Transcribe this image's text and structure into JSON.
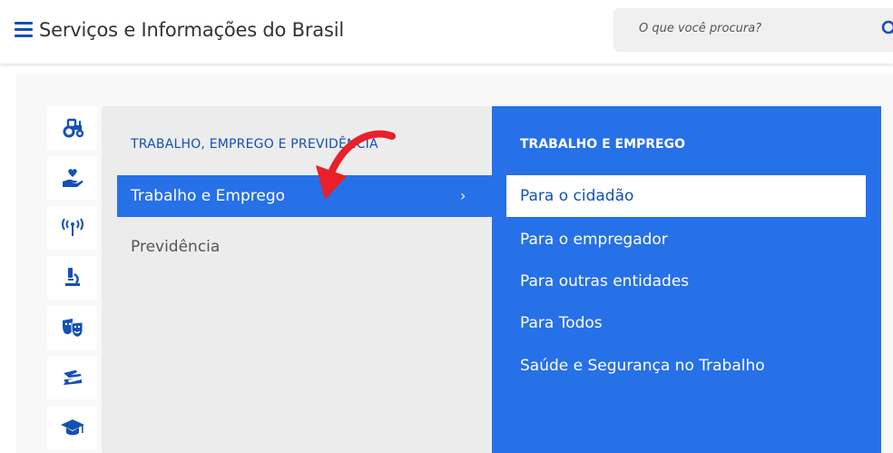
{
  "header": {
    "title": "Serviços e Informações do Brasil",
    "search_placeholder": "O que você procura?"
  },
  "categories": [
    {
      "icon": "tractor-icon"
    },
    {
      "icon": "hand-heart-icon"
    },
    {
      "icon": "antenna-icon"
    },
    {
      "icon": "microscope-icon"
    },
    {
      "icon": "theater-masks-icon"
    },
    {
      "icon": "handshake-icon"
    },
    {
      "icon": "graduation-cap-icon"
    }
  ],
  "menu": {
    "section_title": "TRABALHO, EMPREGO E PREVIDÊNCIA",
    "items": [
      {
        "label": "Trabalho e Emprego",
        "active": true,
        "chevron": "›"
      },
      {
        "label": "Previdência",
        "active": false
      }
    ]
  },
  "submenu": {
    "section_title": "TRABALHO E EMPREGO",
    "items": [
      {
        "label": "Para o cidadão",
        "active": true
      },
      {
        "label": "Para o empregador"
      },
      {
        "label": "Para outras entidades"
      },
      {
        "label": "Para Todos"
      },
      {
        "label": "Saúde e Segurança no Trabalho"
      }
    ]
  },
  "colors": {
    "primary_blue": "#1351b4",
    "accent_blue": "#2670e8",
    "annotation_red": "#e8202a"
  }
}
